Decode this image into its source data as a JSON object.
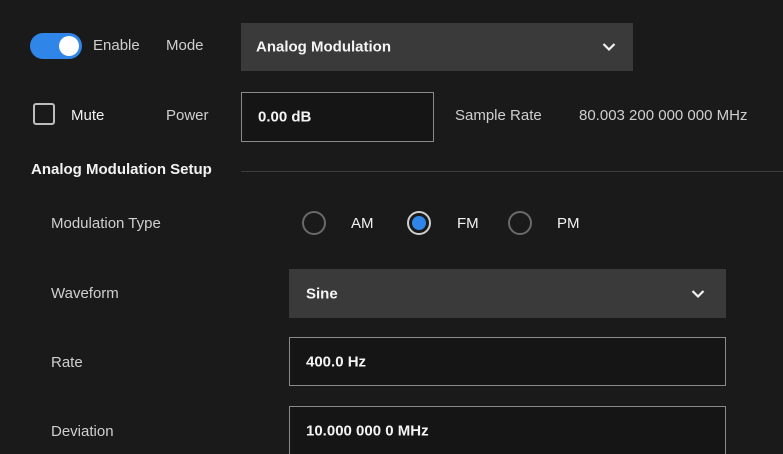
{
  "top": {
    "enable_label": "Enable",
    "enable_on": true,
    "mode_label": "Mode",
    "mode_value": "Analog Modulation",
    "mute_label": "Mute",
    "mute_checked": false,
    "power_label": "Power",
    "power_value": "0.00 dB",
    "sample_rate_label": "Sample Rate",
    "sample_rate_value": "80.003 200 000 000 MHz"
  },
  "setup": {
    "title": "Analog Modulation Setup",
    "modulation_type_label": "Modulation Type",
    "modulation_options": [
      "AM",
      "FM",
      "PM"
    ],
    "modulation_selected": "FM",
    "waveform_label": "Waveform",
    "waveform_value": "Sine",
    "rate_label": "Rate",
    "rate_value": "400.0 Hz",
    "deviation_label": "Deviation",
    "deviation_value": "10.000 000 0 MHz"
  },
  "colors": {
    "background": "#1a1a1a",
    "accent": "#2f86e8",
    "select_bg": "#3a3a3a"
  }
}
